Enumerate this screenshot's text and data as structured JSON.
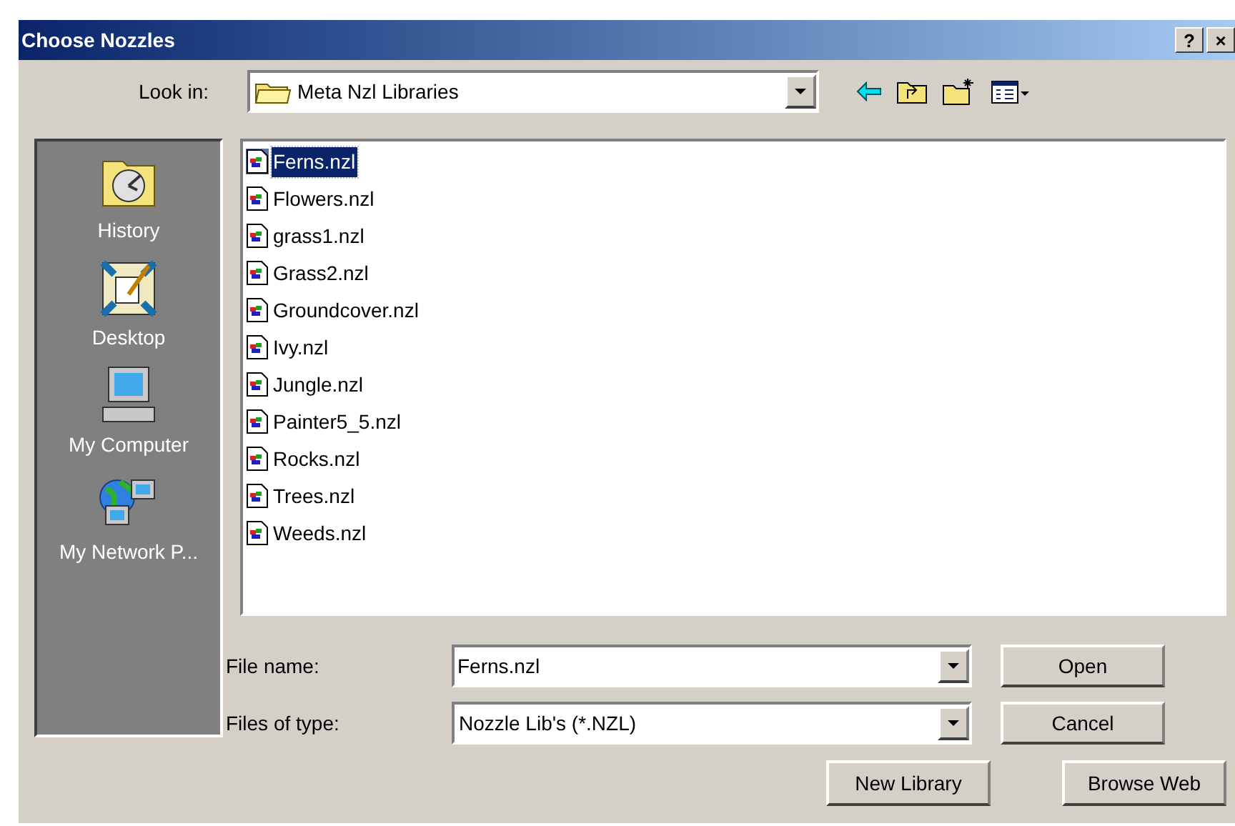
{
  "window": {
    "title": "Choose Nozzles",
    "buttons": [
      "?",
      "×"
    ]
  },
  "look_in": {
    "label": "Look in:",
    "value": "Meta Nzl Libraries"
  },
  "places": [
    {
      "label": "History",
      "kind": "history"
    },
    {
      "label": "Desktop",
      "kind": "desktop"
    },
    {
      "label": "My Computer",
      "kind": "computer"
    },
    {
      "label": "My Network P...",
      "kind": "network"
    }
  ],
  "files": [
    {
      "name": "Ferns.nzl",
      "selected": true
    },
    {
      "name": "Flowers.nzl",
      "selected": false
    },
    {
      "name": "grass1.nzl",
      "selected": false
    },
    {
      "name": "Grass2.nzl",
      "selected": false
    },
    {
      "name": "Groundcover.nzl",
      "selected": false
    },
    {
      "name": "Ivy.nzl",
      "selected": false
    },
    {
      "name": "Jungle.nzl",
      "selected": false
    },
    {
      "name": "Painter5_5.nzl",
      "selected": false
    },
    {
      "name": "Rocks.nzl",
      "selected": false
    },
    {
      "name": "Trees.nzl",
      "selected": false
    },
    {
      "name": "Weeds.nzl",
      "selected": false
    }
  ],
  "file_name": {
    "label": "File name:",
    "value": "Ferns.nzl"
  },
  "file_type": {
    "label": "Files of type:",
    "value": "Nozzle Lib's (*.NZL)"
  },
  "buttons": [
    "Open",
    "Cancel",
    "New Library",
    "Browse Web"
  ]
}
